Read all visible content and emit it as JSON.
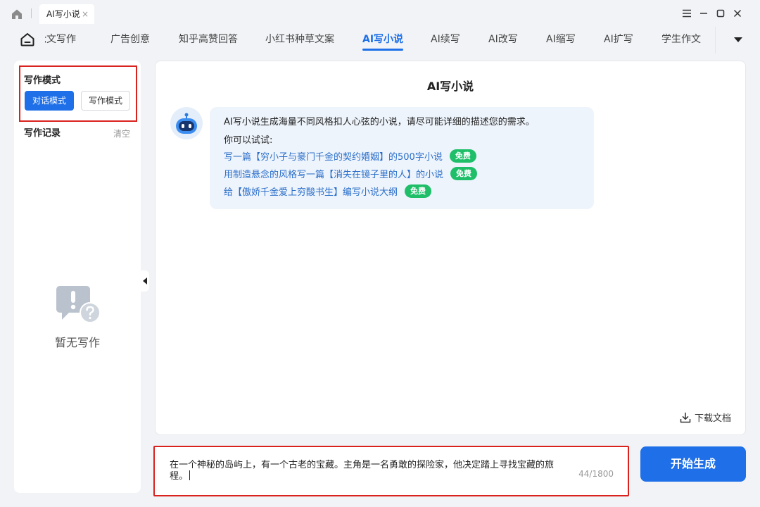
{
  "window": {
    "tab_title": "AI写小说",
    "tab_close": "×"
  },
  "nav": {
    "items": [
      "论文写作",
      "广告创意",
      "知乎高赞回答",
      "小红书种草文案",
      "AI写小说",
      "AI续写",
      "AI改写",
      "AI缩写",
      "AI扩写",
      "学生作文"
    ],
    "active": "AI写小说"
  },
  "sidebar": {
    "mode_title": "写作模式",
    "mode_chat": "对话模式",
    "mode_write": "写作模式",
    "record_title": "写作记录",
    "record_clear": "清空",
    "empty_text": "暂无写作"
  },
  "main": {
    "title": "AI写小说",
    "intro": "AI写小说生成海量不同风格扣人心弦的小说，请尽可能详细的描述您的需求。",
    "try_label": "你可以试试:",
    "suggestions": [
      {
        "text": "写一篇【穷小子与豪门千金的契约婚姻】的500字小说",
        "badge": "免费"
      },
      {
        "text": "用制造悬念的风格写一篇【消失在镜子里的人】的小说",
        "badge": "免费"
      },
      {
        "text": "给【傲娇千金爱上穷酸书生】编写小说大纲",
        "badge": "免费"
      }
    ],
    "download_label": "下载文档"
  },
  "input": {
    "value": "在一个神秘的岛屿上，有一个古老的宝藏。主角是一名勇敢的探险家，他决定踏上寻找宝藏的旅程。",
    "counter": "44/1800"
  },
  "generate_button": "开始生成",
  "colors": {
    "accent": "#1e6fe8",
    "free_badge": "#1fbf6a",
    "highlight_border": "#d9221e"
  },
  "icons": {
    "home": "home-icon",
    "nav_home": "app-home-icon",
    "menu": "menu-icon",
    "minimize": "minimize-icon",
    "maximize": "maximize-icon",
    "close": "close-icon",
    "more": "caret-down-icon",
    "collapse": "caret-left-icon",
    "empty": "empty-chat-question-icon",
    "bot": "robot-avatar-icon",
    "download": "download-icon"
  }
}
